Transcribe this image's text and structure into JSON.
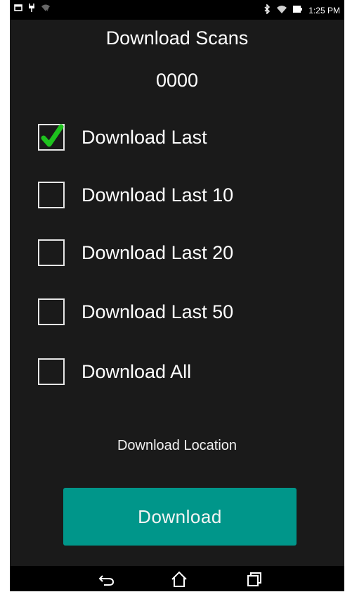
{
  "statusbar": {
    "time": "1:25 PM",
    "icons": [
      "screenshot-icon",
      "usb-icon",
      "wifi-off-icon",
      "bluetooth-icon",
      "wifi-icon",
      "battery-icon"
    ]
  },
  "title": "Download Scans",
  "count": "0000",
  "options": [
    {
      "label": "Download Last",
      "checked": true
    },
    {
      "label": "Download Last 10",
      "checked": false
    },
    {
      "label": "Download Last 20",
      "checked": false
    },
    {
      "label": "Download Last 50",
      "checked": false
    },
    {
      "label": "Download All",
      "checked": false
    }
  ],
  "location_label": "Download Location",
  "download_button": {
    "label": "Download"
  },
  "navbar": {
    "icons": [
      "back-icon",
      "home-icon",
      "recents-icon"
    ]
  },
  "colors": {
    "background": "#1a1a1a",
    "accent": "#00968a",
    "check": "#1ec21e"
  }
}
